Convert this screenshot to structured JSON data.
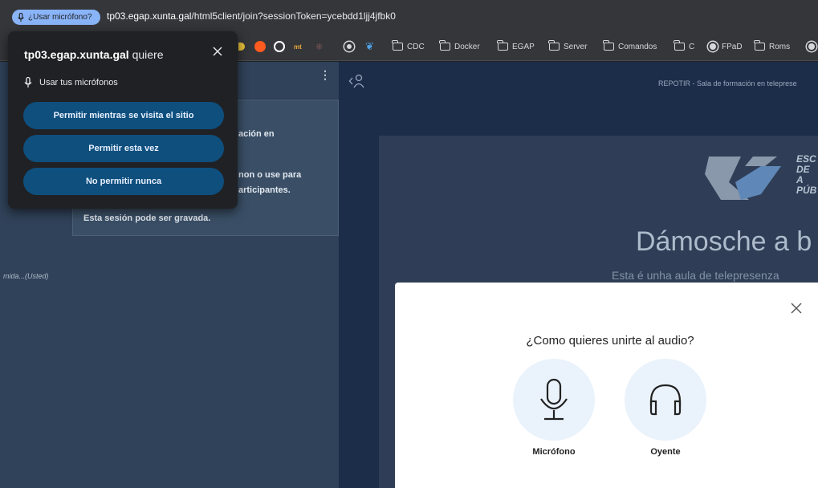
{
  "browser": {
    "permission_chip": "¿Usar micrófono?",
    "url_host": "tp03.egap.xunta.gal",
    "url_path": "/html5client/join?sessionToken=ycebdd1ljj4jfbk0",
    "bookmarks": [
      {
        "label": "CDC",
        "icon": "folder-icon"
      },
      {
        "label": "Docker",
        "icon": "folder-icon"
      },
      {
        "label": "EGAP",
        "icon": "folder-icon"
      },
      {
        "label": "Server",
        "icon": "folder-icon"
      },
      {
        "label": "Comandos",
        "icon": "folder-icon"
      },
      {
        "label": "C",
        "icon": "folder-icon"
      },
      {
        "label": "FPaD",
        "icon": "globe-icon"
      },
      {
        "label": "Roms",
        "icon": "folder-icon"
      }
    ],
    "favicon_labels": {
      "mt": "mt"
    }
  },
  "permission_popup": {
    "site": "tp03.egap.xunta.gal",
    "title_suffix": " quiere",
    "request": "Usar tus micrófonos",
    "buttons": {
      "allow_while_visiting": "Permitir mientras se visita el sitio",
      "allow_once": "Permitir esta vez",
      "never_allow": "No permitir nunca"
    }
  },
  "chat": {
    "welcome_lines": [
      "ación en",
      "non o use para",
      "articipantes.",
      "Esta sesión pode ser gravada."
    ],
    "user_truncated": "mida...(Usted)"
  },
  "main": {
    "meeting_title": "REPOTIR - Sala de formación en teleprese",
    "slide": {
      "logo_text": [
        "ESC",
        "DE A",
        "PÚB"
      ],
      "title": "Dámosche a b",
      "subtitle": "Esta é unha aula de telepresenza"
    }
  },
  "audio_modal": {
    "title": "¿Como quieres unirte al audio?",
    "options": {
      "microphone": "Micrófono",
      "listen_only": "Oyente"
    }
  },
  "colors": {
    "chip_bg": "#8ab4f8",
    "popup_bg": "#202124",
    "popup_button": "#0e4f7e",
    "panel_bg": "#304259",
    "main_bg": "#1b2d49",
    "audio_circle": "#eaf2fb"
  }
}
